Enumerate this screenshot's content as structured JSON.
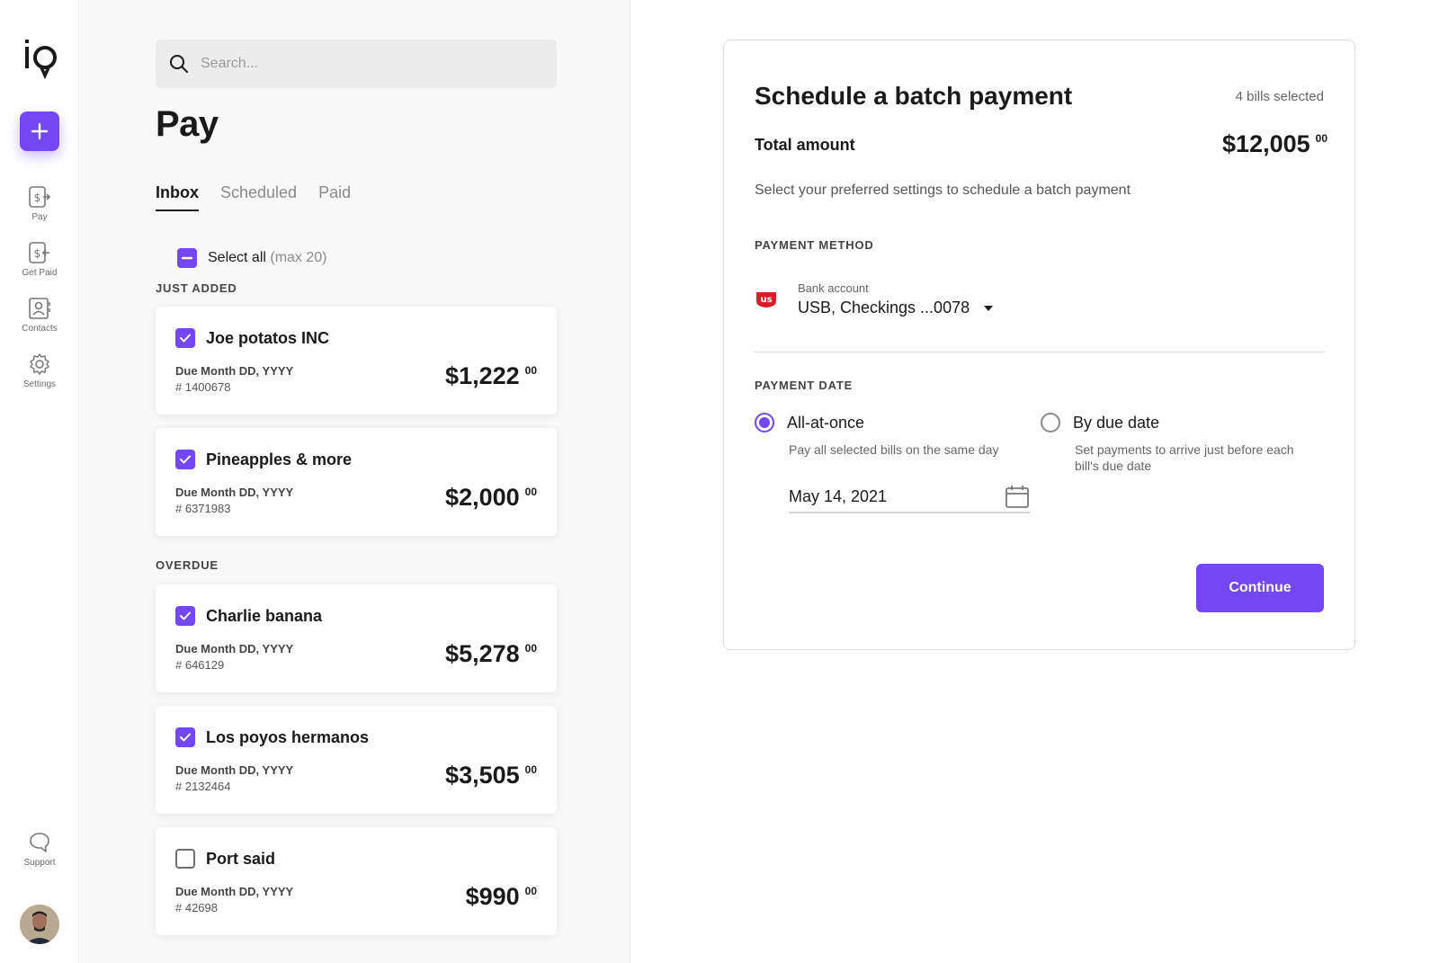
{
  "app": {
    "logo_text": "iq"
  },
  "rail": {
    "add_icon": "plus-icon",
    "items": [
      {
        "label": "Pay",
        "icon": "pay-icon"
      },
      {
        "label": "Get Paid",
        "icon": "get-paid-icon"
      },
      {
        "label": "Contacts",
        "icon": "contacts-icon"
      },
      {
        "label": "Settings",
        "icon": "gear-icon"
      }
    ],
    "support": {
      "label": "Support",
      "icon": "chat-bubble-icon"
    }
  },
  "list": {
    "search_placeholder": "Search...",
    "title": "Pay",
    "tabs": [
      {
        "label": "Inbox",
        "active": true
      },
      {
        "label": "Scheduled",
        "active": false
      },
      {
        "label": "Paid",
        "active": false
      }
    ],
    "select_all": {
      "label": "Select all",
      "hint": "(max 20)"
    },
    "sections": [
      {
        "label": "JUST ADDED"
      },
      {
        "label": "OVERDUE"
      }
    ],
    "bills": [
      {
        "name": "Joe potatos INC",
        "due": "Due Month DD, YYYY",
        "number": "# 1400678",
        "amount": "$1,222",
        "cents": "00",
        "checked": true
      },
      {
        "name": "Pineapples & more",
        "due": "Due Month DD, YYYY",
        "number": "# 6371983",
        "amount": "$2,000",
        "cents": "00",
        "checked": true
      },
      {
        "name": "Charlie banana",
        "due": "Due Month DD, YYYY",
        "number": "# 646129",
        "amount": "$5,278",
        "cents": "00",
        "checked": true
      },
      {
        "name": "Los poyos hermanos",
        "due": "Due Month DD, YYYY",
        "number": "# 2132464",
        "amount": "$3,505",
        "cents": "00",
        "checked": true
      },
      {
        "name": "Port said",
        "due": "Due Month DD, YYYY",
        "number": "# 42698",
        "amount": "$990",
        "cents": "00",
        "checked": false
      }
    ]
  },
  "batch": {
    "title": "Schedule a batch payment",
    "count": "4 bills selected",
    "total_label": "Total amount",
    "total_amount": "$12,005",
    "total_cents": "00",
    "description": "Select your preferred settings to schedule a batch payment",
    "payment_method": {
      "section_label": "PAYMENT METHOD",
      "bank_logo": "us",
      "sub_label": "Bank account",
      "value": "USB, Checkings ...0078"
    },
    "payment_date": {
      "section_label": "PAYMENT DATE",
      "options": [
        {
          "label": "All-at-once",
          "help": "Pay all selected bills on the same day",
          "selected": true
        },
        {
          "label": "By due date",
          "help_line1": "Set payments to arrive just before each",
          "help_line2": "bill's due date",
          "selected": false
        }
      ],
      "date_value": "May 14, 2021"
    },
    "continue_label": "Continue"
  },
  "colors": {
    "accent": "#7347f2",
    "bank_brand": "#d71e28"
  }
}
